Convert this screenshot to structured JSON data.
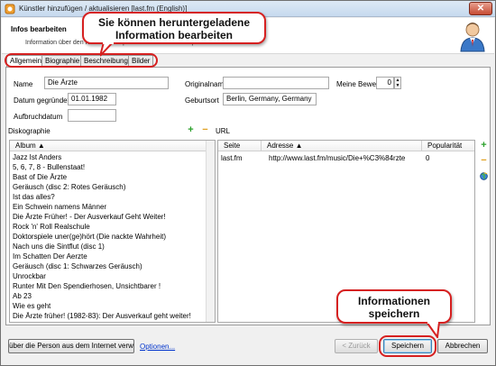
{
  "window": {
    "title": "Künstler hinzufügen / aktualisieren [last.fm (English)]",
    "close_glyph": "✕"
  },
  "header": {
    "title": "Infos bearbeiten",
    "subtitle": "Information über den Künstler überprüfen und ändern und speichern."
  },
  "callouts": {
    "top_line1": "Sie können heruntergeladene",
    "top_line2": "Information bearbeiten",
    "bottom_line1": "Informationen",
    "bottom_line2": "speichern"
  },
  "tabs": [
    "Allgemein",
    "Biographie",
    "Beschreibung",
    "Bilder"
  ],
  "form": {
    "name_label": "Name",
    "name_value": "Die Ärzte",
    "originalname_label": "Originalname",
    "originalname_value": "",
    "rating_label": "Meine Bewert",
    "rating_value": "0",
    "founded_label": "Datum gegründet",
    "founded_value": "01.01.1982",
    "birthplace_label": "Geburtsort",
    "birthplace_value": "Berlin, Germany, Germany",
    "breakup_label": "Aufbruchdatum",
    "breakup_value": ""
  },
  "discography": {
    "label": "Diskographie",
    "column": "Album",
    "albums": [
      "Jazz Ist Anders",
      "5, 6, 7, 8 - Bullenstaat!",
      "Bast of Die Ärzte",
      "Geräusch (disc 2: Rotes Geräusch)",
      "Ist das alles?",
      "Ein Schwein namens Männer",
      "Die Ärzte Früher! - Der Ausverkauf Geht Weiter!",
      "Rock 'n' Roll Realschule",
      "Doktorspiele uner(ge)hört (Die nackte Wahrheit)",
      "Nach uns die Sintflut (disc 1)",
      "Im Schatten Der Aerzte",
      "Geräusch (disc 1: Schwarzes Geräusch)",
      "Unrockbar",
      "Runter Mit Den Spendierhosen, Unsichtbarer !",
      "Ab 23",
      "Wie es geht",
      "Die Ärzte früher! (1982-83): Der Ausverkauf geht weiter!"
    ]
  },
  "urls": {
    "label": "URL",
    "columns": [
      "Seite",
      "Adresse",
      "Popularität"
    ],
    "rows": [
      {
        "site": "last.fm",
        "address": "http://www.last.fm/music/Die+%C3%84rzte",
        "popularity": "0"
      }
    ]
  },
  "footer": {
    "search_button": "über die Person aus dem Internet verw",
    "options_link": "Optionen...",
    "back_button": "< Zurück",
    "save_button": "Speichern",
    "cancel_button": "Abbrechen"
  },
  "colors": {
    "callout_border": "#d62020",
    "link": "#0033cc",
    "add_icon": "#2aa02a",
    "remove_icon": "#e0a020"
  },
  "icons": {
    "app": "app-icon",
    "user": "user-avatar-icon",
    "add": "plus-icon",
    "remove": "minus-icon",
    "globe": "globe-icon"
  }
}
